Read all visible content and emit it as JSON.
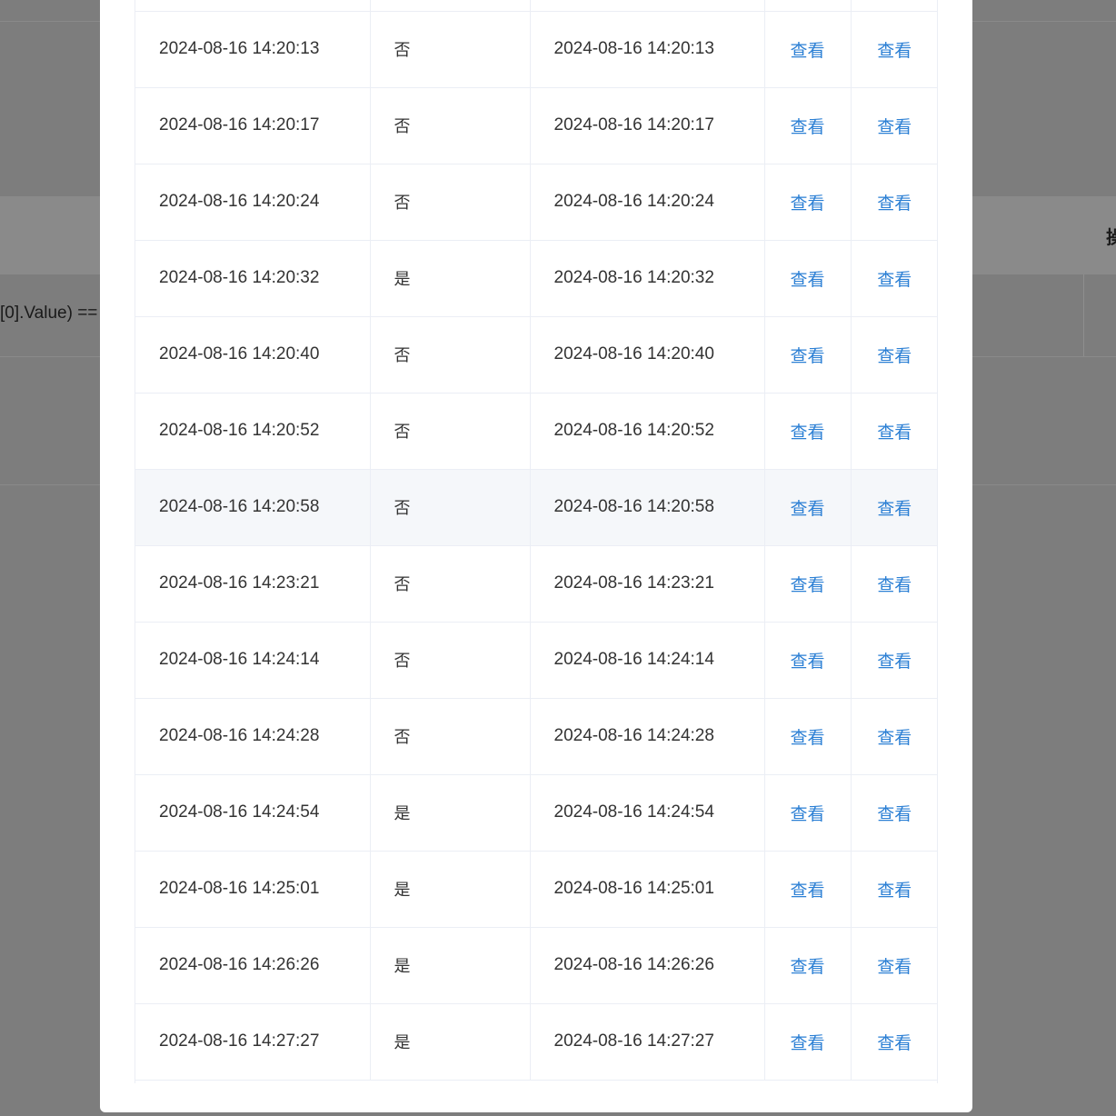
{
  "background": {
    "partial_cell_text": "[0].Value) ==",
    "partial_header_glyph": "操"
  },
  "table": {
    "rows": [
      {
        "time": "2024-08-16 14:20:13",
        "flag": "否",
        "time2": "2024-08-16 14:20:13",
        "action1": "查看",
        "action2": "查看"
      },
      {
        "time": "2024-08-16 14:20:17",
        "flag": "否",
        "time2": "2024-08-16 14:20:17",
        "action1": "查看",
        "action2": "查看"
      },
      {
        "time": "2024-08-16 14:20:24",
        "flag": "否",
        "time2": "2024-08-16 14:20:24",
        "action1": "查看",
        "action2": "查看"
      },
      {
        "time": "2024-08-16 14:20:32",
        "flag": "是",
        "time2": "2024-08-16 14:20:32",
        "action1": "查看",
        "action2": "查看"
      },
      {
        "time": "2024-08-16 14:20:40",
        "flag": "否",
        "time2": "2024-08-16 14:20:40",
        "action1": "查看",
        "action2": "查看"
      },
      {
        "time": "2024-08-16 14:20:52",
        "flag": "否",
        "time2": "2024-08-16 14:20:52",
        "action1": "查看",
        "action2": "查看"
      },
      {
        "time": "2024-08-16 14:20:58",
        "flag": "否",
        "time2": "2024-08-16 14:20:58",
        "action1": "查看",
        "action2": "查看"
      },
      {
        "time": "2024-08-16 14:23:21",
        "flag": "否",
        "time2": "2024-08-16 14:23:21",
        "action1": "查看",
        "action2": "查看"
      },
      {
        "time": "2024-08-16 14:24:14",
        "flag": "否",
        "time2": "2024-08-16 14:24:14",
        "action1": "查看",
        "action2": "查看"
      },
      {
        "time": "2024-08-16 14:24:28",
        "flag": "否",
        "time2": "2024-08-16 14:24:28",
        "action1": "查看",
        "action2": "查看"
      },
      {
        "time": "2024-08-16 14:24:54",
        "flag": "是",
        "time2": "2024-08-16 14:24:54",
        "action1": "查看",
        "action2": "查看"
      },
      {
        "time": "2024-08-16 14:25:01",
        "flag": "是",
        "time2": "2024-08-16 14:25:01",
        "action1": "查看",
        "action2": "查看"
      },
      {
        "time": "2024-08-16 14:26:26",
        "flag": "是",
        "time2": "2024-08-16 14:26:26",
        "action1": "查看",
        "action2": "查看"
      },
      {
        "time": "2024-08-16 14:27:27",
        "flag": "是",
        "time2": "2024-08-16 14:27:27",
        "action1": "查看",
        "action2": "查看"
      }
    ],
    "hovered_row_index": 6
  },
  "colors": {
    "link": "#2b7fd4",
    "mask": "#7d7d7d",
    "row_hover": "#f5f7fa"
  }
}
